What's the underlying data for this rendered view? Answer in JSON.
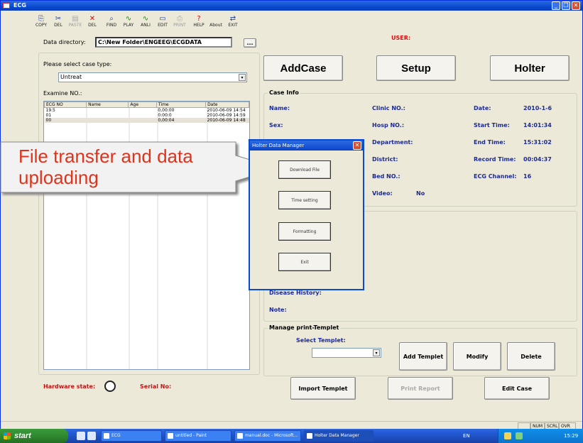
{
  "window": {
    "title": "ECG"
  },
  "toolbar": [
    {
      "label": "COPY",
      "icon": "copy-icon",
      "glyph": "⎘",
      "enabled": true
    },
    {
      "label": "DEL",
      "icon": "trash-icon",
      "glyph": "✂",
      "enabled": true
    },
    {
      "label": "PASTE",
      "icon": "paste-icon",
      "glyph": "▤",
      "enabled": false
    },
    {
      "label": "DEL",
      "icon": "delete-x-icon",
      "glyph": "✕",
      "enabled": true
    },
    {
      "label": "FIND",
      "icon": "magnifier-icon",
      "glyph": "⌕",
      "enabled": true
    },
    {
      "label": "PLAY",
      "icon": "waveform-play-icon",
      "glyph": "∿",
      "enabled": true
    },
    {
      "label": "ANLI",
      "icon": "waveform-analysis-icon",
      "glyph": "∿",
      "enabled": true
    },
    {
      "label": "EDIT",
      "icon": "edit-icon",
      "glyph": "▭",
      "enabled": true
    },
    {
      "label": "PRINT",
      "icon": "printer-icon",
      "glyph": "⎙",
      "enabled": false
    },
    {
      "label": "HELP",
      "icon": "help-icon",
      "glyph": "?",
      "enabled": true
    },
    {
      "label": "About",
      "icon": "about-icon",
      "glyph": "",
      "enabled": true
    },
    {
      "label": "EXIT",
      "icon": "exit-icon",
      "glyph": "⇄",
      "enabled": true
    }
  ],
  "user_label": "USER:",
  "data_directory": {
    "label": "Data directory:",
    "value": "C:\\New Folder\\ENGEEG\\ECGDATA",
    "browse": "..."
  },
  "case_type": {
    "label": "Please select case type:",
    "selected": "Untreat"
  },
  "examine": {
    "label": "Examine NO.:",
    "columns": [
      "ECG NO",
      "Name",
      "Age",
      "Time",
      "Date"
    ],
    "rows": [
      [
        "19.5",
        "",
        "",
        "0,00:00",
        "2010-06-09 14:54"
      ],
      [
        "01",
        "",
        "",
        "0:00:0",
        "2010-06-09 14:59"
      ],
      [
        "00",
        "",
        "",
        "0,00:04",
        "2010-06-09 14:48"
      ]
    ]
  },
  "buttons": {
    "addcase": "AddCase",
    "setup": "Setup",
    "holter": "Holter"
  },
  "case_info": {
    "title": "Case Info",
    "name": "Name:",
    "sex": "Sex:",
    "clinic_no": "Clinic NO.:",
    "hosp_no": "Hosp NO.:",
    "department": "Department:",
    "district": "District:",
    "bed_no": "Bed NO.:",
    "video_label": "Video:",
    "video_value": "No",
    "date_label": "Date:",
    "date_value": "2010-1-6",
    "start_label": "Start Time:",
    "start_value": "14:01:34",
    "end_label": "End Time:",
    "end_value": "15:31:02",
    "record_label": "Record Time:",
    "record_value": "00:04:37",
    "channel_label": "ECG Channel:",
    "channel_value": "16"
  },
  "disease_history": "Disease History:",
  "note": "Note:",
  "print_templet": {
    "title": "Manage print-Templet",
    "select_label": "Select Templet:",
    "add": "Add Templet",
    "modify": "Modify",
    "delete": "Delete"
  },
  "bottom": {
    "hardware_label": "Hardware state:",
    "serial_label": "Serial No:",
    "import": "Import Templet",
    "print_report": "Print Report",
    "edit_case": "Edit Case"
  },
  "status_bar": {
    "cell1": "",
    "num": "NUM",
    "scrl": "SCRL",
    "ovr": "OVR"
  },
  "dialog": {
    "title": "Holter Data Manager",
    "btn1": "Download File",
    "btn2": "Time setting",
    "btn3": "Formatting",
    "btn4": "Exit"
  },
  "callout": {
    "text": "File transfer and data uploading"
  },
  "taskbar": {
    "start": "start",
    "tasks": [
      {
        "label": "ECG",
        "active": false
      },
      {
        "label": "untitled - Paint",
        "active": false
      },
      {
        "label": "manual.doc - Microsoft...",
        "active": false
      },
      {
        "label": "Holter Data Manager",
        "active": true
      }
    ],
    "lang": "EN",
    "clock": "15:29"
  }
}
